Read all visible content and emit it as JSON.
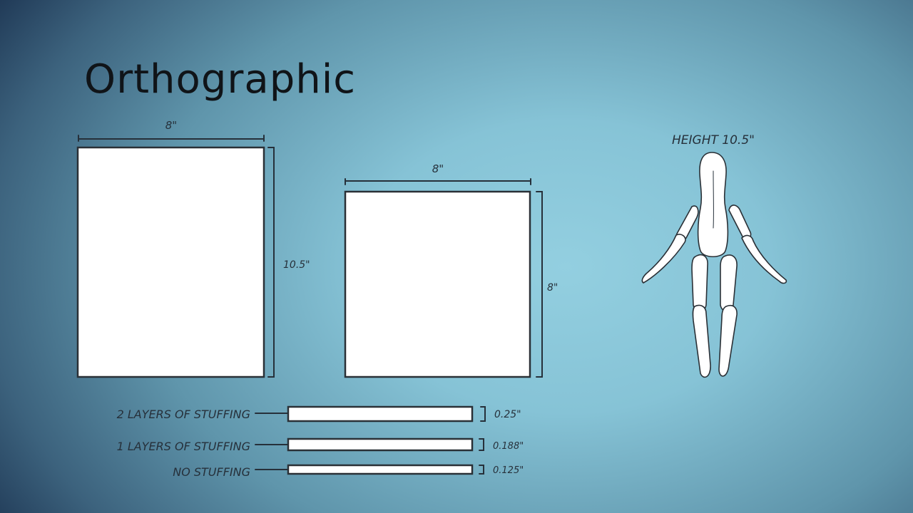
{
  "slide": {
    "title": "Orthographic"
  },
  "front_panel": {
    "width_label": "8\"",
    "height_label": "10.5\""
  },
  "side_panel": {
    "width_label": "8\"",
    "height_label": "8\""
  },
  "figure": {
    "height_label": "HEIGHT 10.5\""
  },
  "stuffing": [
    {
      "label": "2 LAYERS OF STUFFING",
      "thickness": "0.25\""
    },
    {
      "label": "1 LAYERS OF STUFFING",
      "thickness": "0.188\""
    },
    {
      "label": "NO STUFFING",
      "thickness": "0.125\""
    }
  ]
}
